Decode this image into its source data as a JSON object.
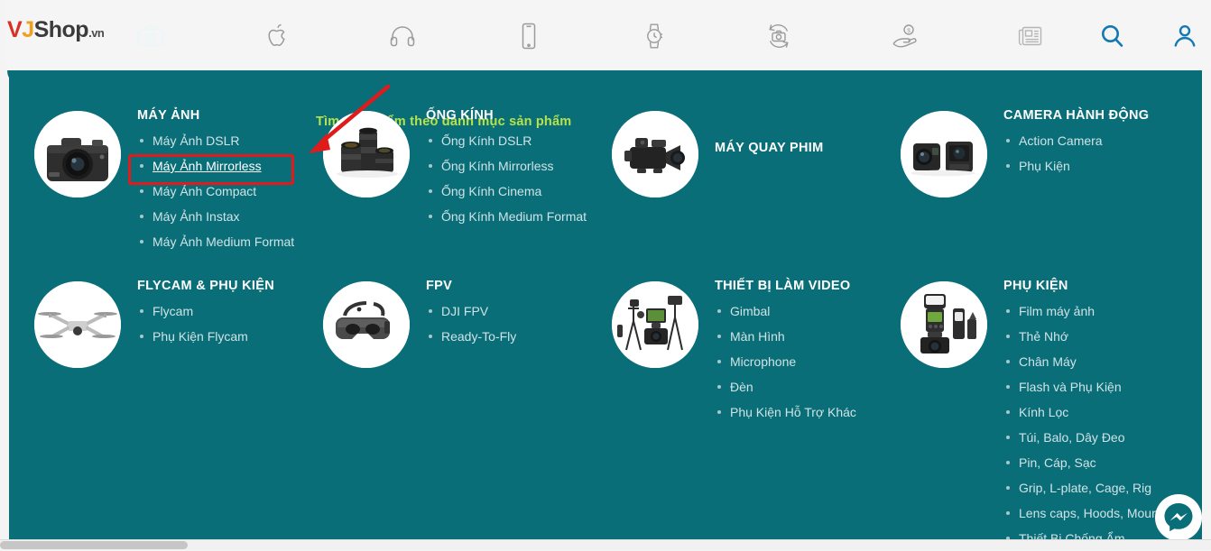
{
  "brand": {
    "logo_v": "V",
    "logo_j": "J",
    "logo_rest": "Shop",
    "logo_domain": ".vn"
  },
  "colors": {
    "panel_teal": "#0a6e78",
    "accent_blue": "#1478b4",
    "annotation_green": "#b6e24a",
    "highlight_red": "#e01b1b",
    "nav_icon_gray": "#9a9a9a"
  },
  "topnav": {
    "items": [
      {
        "name": "camera-icon",
        "label": "Máy ảnh",
        "active": true
      },
      {
        "name": "apple-icon",
        "label": "Apple",
        "active": false
      },
      {
        "name": "headphone-icon",
        "label": "Tai nghe",
        "active": false
      },
      {
        "name": "phone-icon",
        "label": "Điện thoại",
        "active": false
      },
      {
        "name": "watch-icon",
        "label": "Đồng hồ",
        "active": false
      },
      {
        "name": "trade-in-camera-icon",
        "label": "Thu cũ đổi mới",
        "active": false
      },
      {
        "name": "hand-money-icon",
        "label": "Trả góp",
        "active": false
      },
      {
        "name": "news-icon",
        "label": "Tin tức",
        "active": false
      },
      {
        "name": "search-icon",
        "label": "Tìm kiếm",
        "active": false
      },
      {
        "name": "account-icon",
        "label": "Tài khoản",
        "active": false
      }
    ]
  },
  "annotation": {
    "text": "Tìm sản phẩm theo danh mục sản phẩm"
  },
  "megamenu": {
    "categories": [
      {
        "title": "MÁY ẢNH",
        "thumb": "dslr-camera-thumb",
        "items": [
          {
            "label": "Máy Ảnh DSLR",
            "selected": false
          },
          {
            "label": "Máy Ảnh Mirrorless",
            "selected": true
          },
          {
            "label": "Máy Ảnh Compact",
            "selected": false
          },
          {
            "label": "Máy Ảnh Instax",
            "selected": false
          },
          {
            "label": "Máy Ảnh Medium Format",
            "selected": false
          }
        ]
      },
      {
        "title": "ỐNG KÍNH",
        "thumb": "lens-group-thumb",
        "items": [
          {
            "label": "Ống Kính DSLR",
            "selected": false
          },
          {
            "label": "Ống Kính Mirrorless",
            "selected": false
          },
          {
            "label": "Ống Kính Cinema",
            "selected": false
          },
          {
            "label": "Ống Kính Medium Format",
            "selected": false
          }
        ]
      },
      {
        "title": "MÁY QUAY PHIM",
        "thumb": "camcorder-thumb",
        "items": []
      },
      {
        "title": "CAMERA HÀNH ĐỘNG",
        "thumb": "action-camera-thumb",
        "items": [
          {
            "label": "Action Camera",
            "selected": false
          },
          {
            "label": "Phụ Kiện",
            "selected": false
          }
        ]
      },
      {
        "title": "FLYCAM & PHỤ KIỆN",
        "thumb": "drone-thumb",
        "items": [
          {
            "label": "Flycam",
            "selected": false
          },
          {
            "label": "Phụ Kiện Flycam",
            "selected": false
          }
        ]
      },
      {
        "title": "FPV",
        "thumb": "fpv-goggles-thumb",
        "items": [
          {
            "label": "DJI FPV",
            "selected": false
          },
          {
            "label": "Ready-To-Fly",
            "selected": false
          }
        ]
      },
      {
        "title": "THIẾT BỊ LÀM VIDEO",
        "thumb": "video-gear-thumb",
        "items": [
          {
            "label": "Gimbal",
            "selected": false
          },
          {
            "label": "Màn Hình",
            "selected": false
          },
          {
            "label": "Microphone",
            "selected": false
          },
          {
            "label": "Đèn",
            "selected": false
          },
          {
            "label": "Phụ Kiện Hỗ Trợ Khác",
            "selected": false
          }
        ]
      },
      {
        "title": "PHỤ KIỆN",
        "thumb": "flash-accessory-thumb",
        "items": [
          {
            "label": "Film máy ảnh",
            "selected": false
          },
          {
            "label": "Thẻ Nhớ",
            "selected": false
          },
          {
            "label": "Chân Máy",
            "selected": false
          },
          {
            "label": "Flash và Phụ Kiện",
            "selected": false
          },
          {
            "label": "Kính Lọc",
            "selected": false
          },
          {
            "label": "Túi, Balo, Dây Đeo",
            "selected": false
          },
          {
            "label": "Pin, Cáp, Sạc",
            "selected": false
          },
          {
            "label": "Grip, L-plate, Cage, Rig",
            "selected": false
          },
          {
            "label": "Lens caps, Hoods, Moun",
            "selected": false
          },
          {
            "label": "Thiết Bị Chống Ẩm",
            "selected": false
          }
        ]
      }
    ]
  },
  "messenger": {
    "label": "Messenger"
  }
}
